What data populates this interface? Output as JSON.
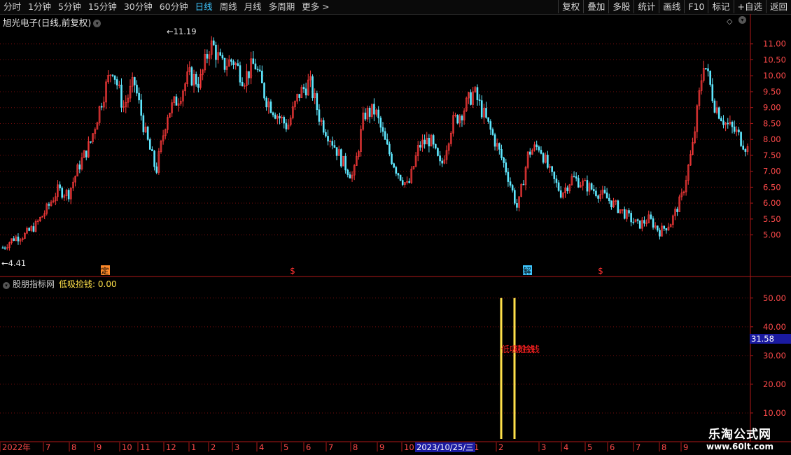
{
  "toolbar": {
    "periods": [
      "分时",
      "1分钟",
      "5分钟",
      "15分钟",
      "30分钟",
      "60分钟",
      "日线",
      "周线",
      "月线",
      "多周期",
      "更多 >"
    ],
    "active_period": "日线",
    "tools": [
      "复权",
      "叠加",
      "多股",
      "统计",
      "画线",
      "F10",
      "标记",
      "+自选",
      "返回"
    ]
  },
  "chart_title": "旭光电子(日线,前复权)",
  "price_axis": [
    "11.00",
    "10.50",
    "10.00",
    "9.50",
    "9.00",
    "8.50",
    "8.00",
    "7.50",
    "7.00",
    "6.50",
    "6.00",
    "5.50",
    "5.00"
  ],
  "high_label": "11.19",
  "low_label": "4.41",
  "signals": [
    {
      "text": "定",
      "color": "#ff8a2a"
    },
    {
      "text": "$",
      "color": "#ff3030"
    },
    {
      "text": "解",
      "color": "#3ec6ff"
    },
    {
      "text": "$",
      "color": "#ff3030"
    }
  ],
  "indicator": {
    "name": "股朋指标网",
    "value_label": "低吸捡钱: 0.00",
    "axis": [
      "50.00",
      "40.00",
      "30.00",
      "20.00",
      "10.00"
    ],
    "current": "31.58",
    "bar_values": [
      50,
      50
    ],
    "bar_label": "低吸捡钱",
    "bar_label_2": "吸捡钱"
  },
  "date_axis": [
    "2022年",
    "7",
    "8",
    "9",
    "10",
    "11",
    "12",
    "1",
    "2",
    "3",
    "4",
    "5",
    "6",
    "7",
    "8",
    "9",
    "10",
    "1",
    "2",
    "3",
    "4",
    "5",
    "6",
    "7",
    "8",
    "9"
  ],
  "date_cursor": "2023/10/25/三",
  "watermark": {
    "line1": "乐淘公式网",
    "line2": "www.60lt.com"
  },
  "colors": {
    "up": "#ff3b3b",
    "down": "#5fe8ff",
    "grid": "#7a0d0d",
    "axis_text": "#ff4a4a",
    "indicator_bar": "#ffe14a"
  },
  "chart_data": {
    "type": "candlestick",
    "title": "旭光电子(日线,前复权)",
    "ylim": [
      4.2,
      11.5
    ],
    "close_series": [
      4.6,
      4.9,
      5.0,
      5.3,
      5.8,
      6.4,
      6.3,
      7.2,
      7.9,
      9.2,
      10.3,
      9.0,
      9.8,
      8.2,
      7.0,
      8.8,
      9.3,
      10.0,
      9.8,
      11.1,
      10.3,
      10.5,
      9.9,
      10.4,
      9.3,
      8.8,
      8.4,
      9.4,
      9.8,
      8.6,
      8.0,
      7.3,
      6.8,
      8.8,
      8.9,
      7.8,
      7.0,
      6.5,
      7.8,
      8.0,
      7.1,
      8.5,
      8.9,
      9.5,
      8.7,
      7.9,
      7.0,
      5.8,
      7.6,
      7.8,
      6.9,
      6.3,
      6.8,
      6.6,
      6.4,
      6.2,
      5.9,
      5.6,
      5.3,
      5.5,
      5.1,
      5.4,
      6.2,
      7.8,
      10.5,
      9.1,
      8.5,
      8.2,
      7.7
    ]
  }
}
